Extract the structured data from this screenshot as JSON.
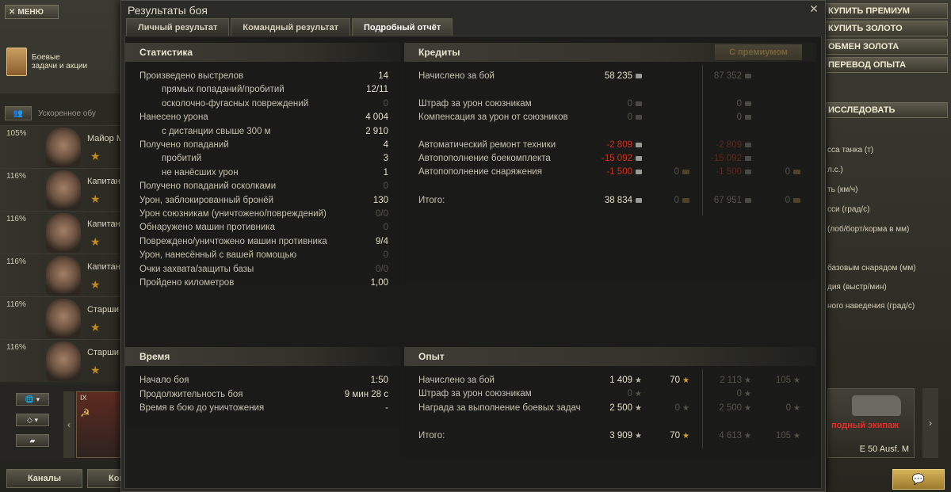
{
  "background": {
    "menu_label": "МЕНЮ",
    "missions_label_1": "Боевые",
    "missions_label_2": "задачи и акции",
    "quick_label": "Ускоренное обу",
    "crew": [
      {
        "pct": "105%",
        "rank": "Майор М"
      },
      {
        "pct": "116%",
        "rank": "Капитан"
      },
      {
        "pct": "116%",
        "rank": "Капитан"
      },
      {
        "pct": "116%",
        "rank": "Капитан"
      },
      {
        "pct": "116%",
        "rank": "Старши"
      },
      {
        "pct": "116%",
        "rank": "Старши"
      }
    ],
    "tank_tier": "IX",
    "channels_label": "Каналы",
    "channels2_label": "Кон",
    "right_buttons": [
      "КУПИТЬ ПРЕМИУМ",
      "КУПИТЬ ЗОЛОТО",
      "ОБМЕН ЗОЛОТА",
      "ПЕРЕВОД ОПЫТА",
      "ИССЛЕДОВАТЬ"
    ],
    "right_info": [
      "сса танка (т)",
      "л.с.)",
      "ть (км/ч)",
      "сси (град/с)",
      "(лоб/борт/корма в мм)",
      "базовым снарядом (мм)",
      "дия (выстр/мин)",
      "ного наведения (град/с)"
    ],
    "tank_card_name": "подный экипаж",
    "tank_card_model": "E 50 Ausf. M"
  },
  "window": {
    "title": "Результаты боя",
    "tabs": [
      "Личный результат",
      "Командный результат",
      "Подробный отчёт"
    ],
    "active_tab": 2
  },
  "stats": {
    "heading": "Статистика",
    "rows": [
      {
        "label": "Произведено выстрелов",
        "value": "14",
        "indent": false,
        "dim": false
      },
      {
        "label": "прямых попаданий/пробитий",
        "value": "12/11",
        "indent": true,
        "dim": false
      },
      {
        "label": "осколочно-фугасных повреждений",
        "value": "0",
        "indent": true,
        "dim": true
      },
      {
        "label": "Нанесено урона",
        "value": "4 004",
        "indent": false,
        "dim": false
      },
      {
        "label": "с дистанции свыше 300 м",
        "value": "2 910",
        "indent": true,
        "dim": false
      },
      {
        "label": "Получено попаданий",
        "value": "4",
        "indent": false,
        "dim": false
      },
      {
        "label": "пробитий",
        "value": "3",
        "indent": true,
        "dim": false
      },
      {
        "label": "не нанёсших урон",
        "value": "1",
        "indent": true,
        "dim": false
      },
      {
        "label": "Получено попаданий осколками",
        "value": "0",
        "indent": false,
        "dim": true
      },
      {
        "label": "Урон, заблокированный бронёй",
        "value": "130",
        "indent": false,
        "dim": false
      },
      {
        "label": "Урон союзникам (уничтожено/повреждений)",
        "value": "0/0",
        "indent": false,
        "dim": true
      },
      {
        "label": "Обнаружено машин противника",
        "value": "0",
        "indent": false,
        "dim": true
      },
      {
        "label": "Повреждено/уничтожено машин противника",
        "value": "9/4",
        "indent": false,
        "dim": false
      },
      {
        "label": "Урон, нанесённый с вашей помощью",
        "value": "0",
        "indent": false,
        "dim": true
      },
      {
        "label": "Очки захвата/защиты базы",
        "value": "0/0",
        "indent": false,
        "dim": true
      },
      {
        "label": "Пройдено километров",
        "value": "1,00",
        "indent": false,
        "dim": false
      }
    ]
  },
  "credits": {
    "heading": "Кредиты",
    "premium_heading": "С премиумом",
    "rows": [
      {
        "label": "Начислено за бой",
        "c": "58 235",
        "g": "",
        "pc": "87 352",
        "pg": "",
        "cdim": false,
        "cred": false
      },
      {
        "label": "Штраф за урон союзникам",
        "c": "0",
        "g": "",
        "pc": "0",
        "pg": "",
        "cdim": true,
        "cred": false
      },
      {
        "label": "Компенсация за урон от союзников",
        "c": "0",
        "g": "",
        "pc": "0",
        "pg": "",
        "cdim": true,
        "cred": false
      },
      {
        "label": "Автоматический ремонт техники",
        "c": "-2 809",
        "g": "",
        "pc": "-2 809",
        "pg": "",
        "cdim": false,
        "cred": true
      },
      {
        "label": "Автопополнение боекомплекта",
        "c": "-15 092",
        "g": "",
        "pc": "-15 092",
        "pg": "",
        "cdim": false,
        "cred": true
      },
      {
        "label": "Автопополнение снаряжения",
        "c": "-1 500",
        "g": "0",
        "pc": "-1 500",
        "pg": "0",
        "cdim": false,
        "cred": true
      },
      {
        "label": "Итого:",
        "c": "38 834",
        "g": "0",
        "pc": "67 951",
        "pg": "0",
        "cdim": false,
        "cred": false
      }
    ]
  },
  "time": {
    "heading": "Время",
    "rows": [
      {
        "label": "Начало боя",
        "value": "1:50",
        "dim": false
      },
      {
        "label": "Продолжительность боя",
        "value": "9 мин 28 с",
        "dim": false
      },
      {
        "label": "Время в бою до уничтожения",
        "value": "-",
        "dim": false
      }
    ]
  },
  "experience": {
    "heading": "Опыт",
    "rows": [
      {
        "label": "Начислено за бой",
        "xp": "1 409",
        "fxp": "70",
        "pxp": "2 113",
        "pfxp": "105",
        "xpdim": false,
        "fdim": false
      },
      {
        "label": "Штраф за урон союзникам",
        "xp": "0",
        "fxp": "",
        "pxp": "0",
        "pfxp": "",
        "xpdim": true,
        "fdim": true
      },
      {
        "label": "Награда за выполнение боевых задач",
        "xp": "2 500",
        "fxp": "0",
        "pxp": "2 500",
        "pfxp": "0",
        "xpdim": false,
        "fdim": true
      },
      {
        "label": "Итого:",
        "xp": "3 909",
        "fxp": "70",
        "pxp": "4 613",
        "pfxp": "105",
        "xpdim": false,
        "fdim": false
      }
    ]
  },
  "colors": {
    "negative": "#d03020",
    "gold_icon": "#b08a30",
    "accent_button": "#d6b45a"
  }
}
